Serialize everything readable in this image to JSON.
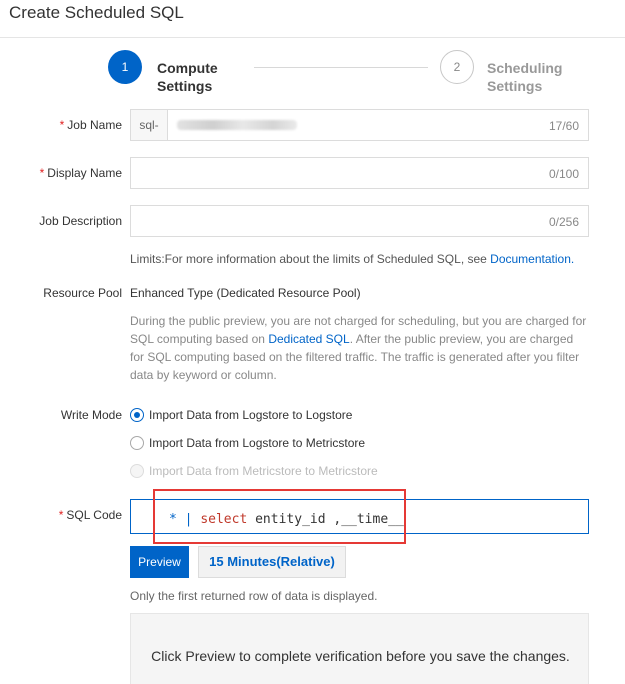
{
  "header": {
    "title": "Create Scheduled SQL"
  },
  "steps": [
    {
      "number": "1",
      "line1": "Compute",
      "line2": "Settings",
      "state": "active"
    },
    {
      "number": "2",
      "line1": "Scheduling",
      "line2": "Settings",
      "state": "inactive"
    }
  ],
  "form": {
    "job_name": {
      "label": "Job Name",
      "prefix": "sql-",
      "counter": "17/60"
    },
    "display_name": {
      "label": "Display Name",
      "value": "",
      "counter": "0/100"
    },
    "job_description": {
      "label": "Job Description",
      "value": "",
      "counter": "0/256"
    },
    "limits": {
      "text": "Limits:For more information about the limits of Scheduled SQL, see ",
      "link": "Documentation."
    },
    "resource_pool": {
      "label": "Resource Pool",
      "value": "Enhanced Type (Dedicated Resource Pool)",
      "desc_part1": "During the public preview, you are not charged for scheduling, but you are charged for SQL computing based on ",
      "desc_link": "Dedicated SQL",
      "desc_part2": ". After the public preview, you are charged for SQL computing based on the filtered traffic. The traffic is generated after you filter data by keyword or column."
    },
    "write_mode": {
      "label": "Write Mode",
      "options": [
        {
          "label": "Import Data from Logstore to Logstore",
          "checked": true,
          "disabled": false
        },
        {
          "label": "Import Data from Logstore to Metricstore",
          "checked": false,
          "disabled": false
        },
        {
          "label": "Import Data from Metricstore to Metricstore",
          "checked": false,
          "disabled": true
        }
      ]
    },
    "sql_code": {
      "label": "SQL Code",
      "tokens": {
        "star": "* ",
        "pipe": "| ",
        "select": "select ",
        "rest": "entity_id ,__time__"
      }
    }
  },
  "preview": {
    "button": "Preview",
    "range": "15 Minutes(Relative)",
    "note": "Only the first returned row of data is displayed.",
    "message": "Click Preview to complete verification before you save the changes."
  },
  "colors": {
    "accent": "#0064c8",
    "required": "#e02020",
    "highlight": "#e53935"
  }
}
